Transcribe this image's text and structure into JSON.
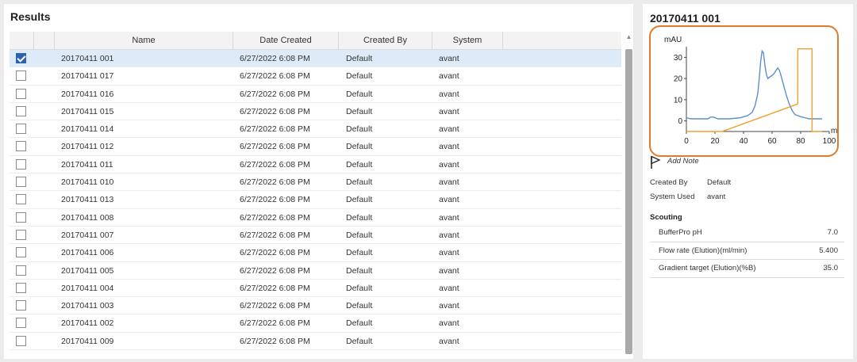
{
  "results": {
    "title": "Results",
    "columns": {
      "name": "Name",
      "date_created": "Date Created",
      "created_by": "Created By",
      "system": "System"
    },
    "rows": [
      {
        "name": "20170411 001",
        "date": "6/27/2022 6:08 PM",
        "created_by": "Default",
        "system": "avant",
        "checked": true
      },
      {
        "name": "20170411 017",
        "date": "6/27/2022 6:08 PM",
        "created_by": "Default",
        "system": "avant",
        "checked": false
      },
      {
        "name": "20170411 016",
        "date": "6/27/2022 6:08 PM",
        "created_by": "Default",
        "system": "avant",
        "checked": false
      },
      {
        "name": "20170411 015",
        "date": "6/27/2022 6:08 PM",
        "created_by": "Default",
        "system": "avant",
        "checked": false
      },
      {
        "name": "20170411 014",
        "date": "6/27/2022 6:08 PM",
        "created_by": "Default",
        "system": "avant",
        "checked": false
      },
      {
        "name": "20170411 012",
        "date": "6/27/2022 6:08 PM",
        "created_by": "Default",
        "system": "avant",
        "checked": false
      },
      {
        "name": "20170411 011",
        "date": "6/27/2022 6:08 PM",
        "created_by": "Default",
        "system": "avant",
        "checked": false
      },
      {
        "name": "20170411 010",
        "date": "6/27/2022 6:08 PM",
        "created_by": "Default",
        "system": "avant",
        "checked": false
      },
      {
        "name": "20170411 013",
        "date": "6/27/2022 6:08 PM",
        "created_by": "Default",
        "system": "avant",
        "checked": false
      },
      {
        "name": "20170411 008",
        "date": "6/27/2022 6:08 PM",
        "created_by": "Default",
        "system": "avant",
        "checked": false
      },
      {
        "name": "20170411 007",
        "date": "6/27/2022 6:08 PM",
        "created_by": "Default",
        "system": "avant",
        "checked": false
      },
      {
        "name": "20170411 006",
        "date": "6/27/2022 6:08 PM",
        "created_by": "Default",
        "system": "avant",
        "checked": false
      },
      {
        "name": "20170411 005",
        "date": "6/27/2022 6:08 PM",
        "created_by": "Default",
        "system": "avant",
        "checked": false
      },
      {
        "name": "20170411 004",
        "date": "6/27/2022 6:08 PM",
        "created_by": "Default",
        "system": "avant",
        "checked": false
      },
      {
        "name": "20170411 003",
        "date": "6/27/2022 6:08 PM",
        "created_by": "Default",
        "system": "avant",
        "checked": false
      },
      {
        "name": "20170411 002",
        "date": "6/27/2022 6:08 PM",
        "created_by": "Default",
        "system": "avant",
        "checked": false
      },
      {
        "name": "20170411 009",
        "date": "6/27/2022 6:08 PM",
        "created_by": "Default",
        "system": "avant",
        "checked": false
      }
    ]
  },
  "detail": {
    "title": "20170411 001",
    "add_note_label": "Add Note",
    "flag_icon": "flag-icon",
    "created_by_label": "Created By",
    "created_by_value": "Default",
    "system_used_label": "System Used",
    "system_used_value": "avant",
    "scouting_label": "Scouting",
    "scouting": [
      {
        "label": "BufferPro pH",
        "value": "7.0"
      },
      {
        "label": "Flow rate (Elution)(ml/min)",
        "value": "5.400"
      },
      {
        "label": "Gradient target (Elution)(%B)",
        "value": "35.0"
      }
    ]
  },
  "colors": {
    "accent_orange": "#e07a2c",
    "uv_blue": "#5b8fd0",
    "gradient_orange": "#f0a030",
    "selection": "#ddeaf7",
    "checkbox_blue": "#2a62ad"
  },
  "chart_data": {
    "type": "line",
    "ylabel": "mAU",
    "xlabel": "ml",
    "xlim": [
      0,
      100
    ],
    "ylim": [
      -5,
      35
    ],
    "xticks": [
      "0",
      "20",
      "40",
      "60",
      "80",
      "100"
    ],
    "yticks": [
      "0",
      "10",
      "20",
      "30"
    ],
    "series": [
      {
        "points": [
          [
            0,
            1.5
          ],
          [
            3,
            1
          ],
          [
            10,
            1
          ],
          [
            15,
            1
          ],
          [
            17,
            1.8
          ],
          [
            19,
            1.8
          ],
          [
            22,
            1
          ],
          [
            30,
            1
          ],
          [
            38,
            1.5
          ],
          [
            43,
            2.5
          ],
          [
            46,
            4
          ],
          [
            48,
            7
          ],
          [
            50,
            13
          ],
          [
            51,
            20
          ],
          [
            52,
            28
          ],
          [
            53,
            33
          ],
          [
            54,
            32
          ],
          [
            55,
            26
          ],
          [
            56,
            22
          ],
          [
            57,
            20
          ],
          [
            59,
            21
          ],
          [
            61,
            22
          ],
          [
            63,
            24
          ],
          [
            64,
            25
          ],
          [
            65,
            24
          ],
          [
            66,
            22
          ],
          [
            68,
            17
          ],
          [
            70,
            12
          ],
          [
            72,
            8
          ],
          [
            74,
            5
          ],
          [
            76,
            3
          ],
          [
            80,
            2
          ],
          [
            86,
            1
          ],
          [
            90,
            1
          ],
          [
            95,
            1
          ]
        ]
      },
      {
        "points": [
          [
            0,
            -5
          ],
          [
            25,
            -5
          ],
          [
            78,
            8
          ],
          [
            78,
            8
          ],
          [
            78,
            34
          ],
          [
            88,
            34
          ],
          [
            88,
            -5
          ],
          [
            95,
            -5
          ]
        ]
      }
    ]
  }
}
